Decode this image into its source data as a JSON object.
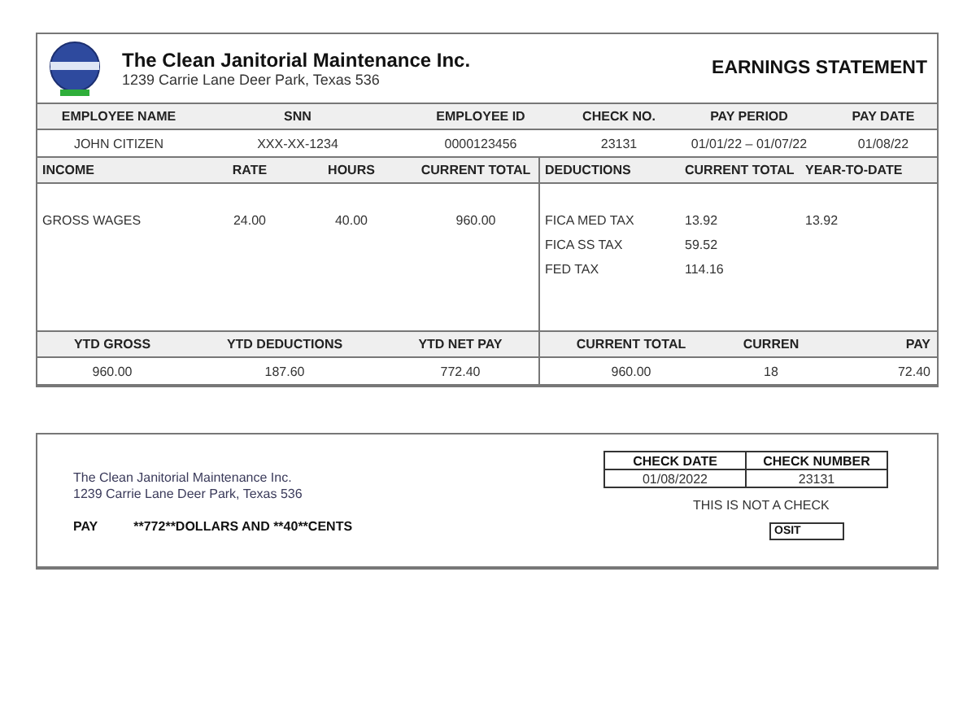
{
  "company": {
    "name": "The Clean Janitorial Maintenance Inc.",
    "address": "1239 Carrie Lane Deer Park, Texas 536"
  },
  "title": "EARNINGS STATEMENT",
  "employee_info": {
    "columns": [
      "EMPLOYEE NAME",
      "SNN",
      "EMPLOYEE ID",
      "CHECK NO.",
      "PAY PERIOD",
      "PAY DATE"
    ],
    "values": [
      "JOHN CITIZEN",
      "XXX-XX-1234",
      "0000123456",
      "23131",
      "01/01/22 – 01/07/22",
      "01/08/22"
    ]
  },
  "income": {
    "columns": [
      "INCOME",
      "RATE",
      "HOURS",
      "CURRENT TOTAL"
    ],
    "rows": [
      [
        "GROSS WAGES",
        "24.00",
        "40.00",
        "960.00"
      ]
    ]
  },
  "deductions": {
    "columns": [
      "DEDUCTIONS",
      "CURRENT TOTAL",
      "YEAR-TO-DATE"
    ],
    "rows": [
      {
        "name": "FICA MED TAX",
        "current": "13.92",
        "ytd": "13.92"
      },
      {
        "name": "FICA SS TAX",
        "current": "59.52"
      },
      {
        "name": "FED TAX",
        "current": "114.16"
      }
    ]
  },
  "summary_left": {
    "columns": [
      "YTD GROSS",
      "YTD DEDUCTIONS",
      "YTD NET PAY"
    ],
    "values": [
      "960.00",
      "187.60",
      "772.40"
    ]
  },
  "summary_right": {
    "columns": [
      "CURRENT TOTAL",
      "CURREN",
      "PAY"
    ],
    "values": [
      "960.00",
      "18",
      "72.40"
    ]
  },
  "check": {
    "company_name": "The Clean Janitorial Maintenance Inc.",
    "address": "1239 Carrie Lane Deer Park, Texas 536",
    "pay_label": "PAY",
    "pay_amount": "**772**DOLLARS  AND **40**CENTS",
    "table": {
      "columns": [
        "CHECK DATE",
        "CHECK NUMBER"
      ],
      "values": [
        "01/08/2022",
        "23131"
      ]
    },
    "notice": "THIS IS NOT A CHECK",
    "deposit": "OSIT"
  }
}
